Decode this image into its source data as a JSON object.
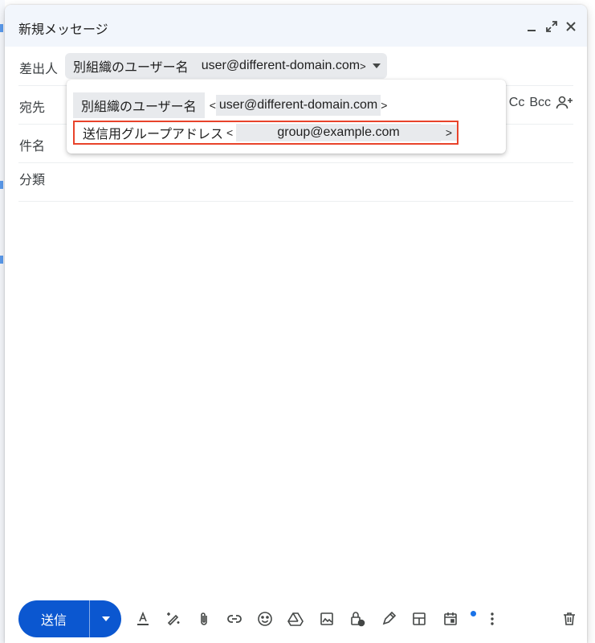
{
  "window": {
    "title": "新規メッセージ",
    "minimize_icon": "minimize-icon",
    "expand_icon": "expand-icon",
    "close_icon": "close-icon"
  },
  "from": {
    "label": "差出人",
    "selected_name": "別組織のユーザー名",
    "selected_address": "user@different-domain.com",
    "suffix": ">",
    "caret_icon": "caret-down-icon"
  },
  "to": {
    "label": "宛先",
    "cc_label": "Cc",
    "bcc_label": "Bcc",
    "add_recipient_icon": "person-add-icon"
  },
  "subject": {
    "label": "件名"
  },
  "category": {
    "label": "分類"
  },
  "from_dropdown": {
    "options": [
      {
        "name": "別組織のユーザー名",
        "open": "<",
        "address": "user@different-domain.com",
        "close": ">"
      },
      {
        "name": "送信用グループアドレス",
        "open": "<",
        "address": "group@example.com",
        "close": ">"
      }
    ],
    "highlight_color": "#e8432b"
  },
  "toolbar": {
    "send_label": "送信",
    "send_color": "#0b57d0",
    "icons": [
      "format-text-icon",
      "ai-assist-icon",
      "attach-icon",
      "link-icon",
      "emoji-icon",
      "drive-icon",
      "image-icon",
      "confidential-lock-icon",
      "signature-pen-icon",
      "layout-icon",
      "schedule-calendar-icon",
      "more-options-icon",
      "delete-trash-icon"
    ]
  }
}
